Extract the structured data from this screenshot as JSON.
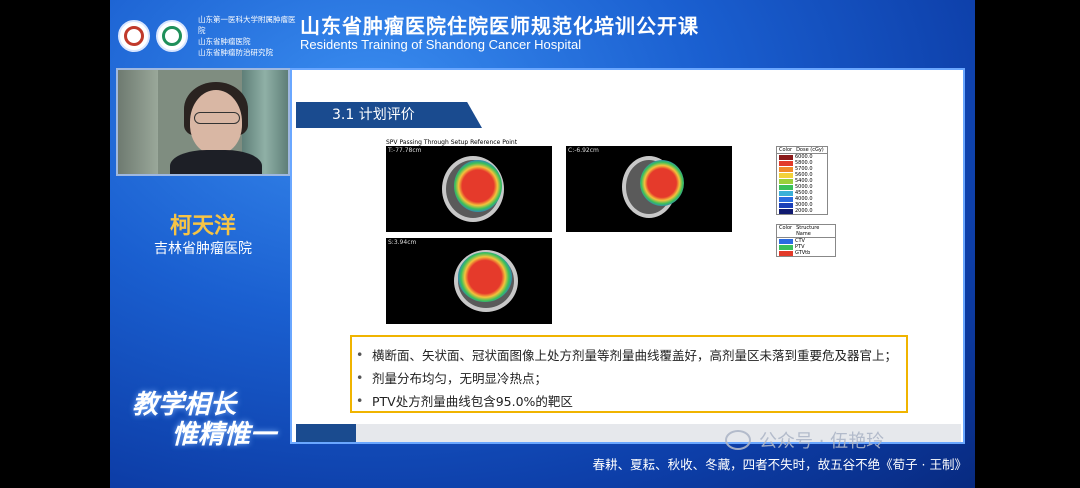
{
  "header": {
    "logo_text_lines": [
      "山东第一医科大学附属肿瘤医院",
      "山东省肿瘤医院",
      "山东省肿瘤防治研究院"
    ],
    "title": "山东省肿瘤医院住院医师规范化培训公开课",
    "subtitle": "Residents Training of Shandong Cancer Hospital"
  },
  "speaker": {
    "name": "柯天洋",
    "organization": "吉林省肿瘤医院"
  },
  "calligraphy": {
    "line1": "教学相长",
    "line2": "惟精惟一"
  },
  "slide": {
    "section_title": "3.1 计划评价",
    "scan_title": "SPV Passing Through Setup Reference Point",
    "scans": [
      {
        "caption": "T:-77.78cm"
      },
      {
        "caption": "C:-6.92cm"
      },
      {
        "caption": "S:3.94cm"
      }
    ],
    "dose_legend": {
      "col1": "Color",
      "col2": "Dose (cGy)",
      "rows": [
        {
          "color": "#8b1a1a",
          "value": "6000.0"
        },
        {
          "color": "#e23a2a",
          "value": "5800.0"
        },
        {
          "color": "#f08a2a",
          "value": "5700.0"
        },
        {
          "color": "#f3d23a",
          "value": "5600.0"
        },
        {
          "color": "#9ad03a",
          "value": "5400.0"
        },
        {
          "color": "#3ac05a",
          "value": "5000.0"
        },
        {
          "color": "#3ab0d8",
          "value": "4500.0"
        },
        {
          "color": "#2a6be0",
          "value": "4000.0"
        },
        {
          "color": "#1a3fb8",
          "value": "3000.0"
        },
        {
          "color": "#101a70",
          "value": "2000.0"
        }
      ]
    },
    "structure_legend": {
      "col1": "Color",
      "col2": "Structure Name",
      "rows": [
        {
          "color": "#2a6be0",
          "value": "CTV"
        },
        {
          "color": "#3ac05a",
          "value": "PTV"
        },
        {
          "color": "#e23a2a",
          "value": "GTVtb"
        }
      ]
    },
    "bullets": [
      "横断面、矢状面、冠状面图像上处方剂量等剂量曲线覆盖好，高剂量区未落到重要危及器官上；",
      "剂量分布均匀，无明显冷热点；",
      "PTV处方剂量曲线包含95.0%的靶区"
    ],
    "bullet_symbol": "•"
  },
  "watermark": "公众号 · 伍艳玲",
  "ticker": "春耕、夏耘、秋收、冬藏，四者不失时，故五谷不绝《荀子 · 王制》"
}
